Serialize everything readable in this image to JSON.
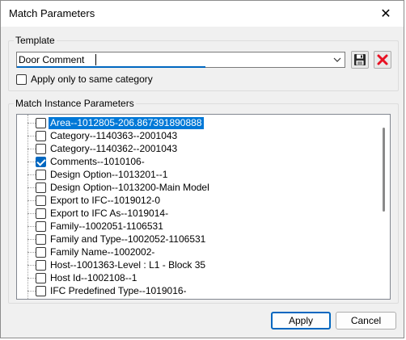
{
  "window": {
    "title": "Match Parameters",
    "close_glyph": "✕"
  },
  "template": {
    "legend": "Template",
    "value": "Door Comment",
    "apply_same_category_label": "Apply only to same category",
    "apply_same_category_checked": false
  },
  "match": {
    "legend": "Match Instance Parameters",
    "items": [
      {
        "label": "Area--1012805-206.867391890888",
        "checked": false,
        "selected": true
      },
      {
        "label": "Category--1140363--2001043",
        "checked": false
      },
      {
        "label": "Category--1140362--2001043",
        "checked": false
      },
      {
        "label": "Comments--1010106-",
        "checked": true
      },
      {
        "label": "Design Option--1013201--1",
        "checked": false
      },
      {
        "label": "Design Option--1013200-Main Model",
        "checked": false
      },
      {
        "label": "Export to IFC--1019012-0",
        "checked": false
      },
      {
        "label": "Export to IFC As--1019014-",
        "checked": false
      },
      {
        "label": "Family--1002051-1106531",
        "checked": false
      },
      {
        "label": "Family and Type--1002052-1106531",
        "checked": false
      },
      {
        "label": "Family Name--1002002-",
        "checked": false
      },
      {
        "label": "Host--1001363-Level : L1 - Block 35",
        "checked": false
      },
      {
        "label": "Host Id--1002108--1",
        "checked": false
      },
      {
        "label": "IFC Predefined Type--1019016-",
        "checked": false
      }
    ]
  },
  "buttons": {
    "apply": "Apply",
    "cancel": "Cancel"
  },
  "colors": {
    "accent": "#0067c0",
    "selection": "#0078d7",
    "delete": "#e81123"
  },
  "icons": {
    "save": "floppy-disk-icon",
    "delete": "red-x-icon",
    "dropdown": "chevron-down-icon"
  }
}
